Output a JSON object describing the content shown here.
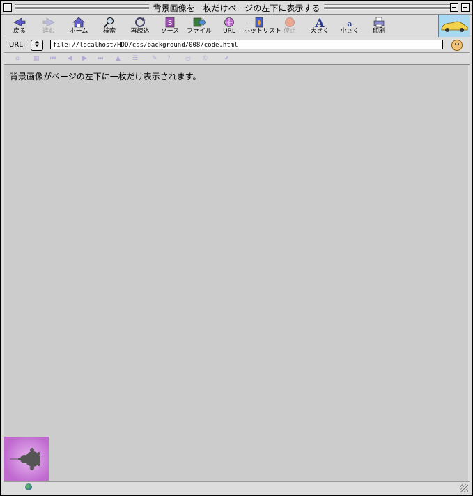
{
  "window": {
    "title": "背景画像を一枚だけページの左下に表示する"
  },
  "toolbar": {
    "buttons": [
      {
        "label": "戻る",
        "icon": "back-arrow-icon"
      },
      {
        "label": "進む",
        "icon": "forward-arrow-icon",
        "disabled": true
      },
      {
        "label": "ホーム",
        "icon": "home-icon"
      },
      {
        "label": "検索",
        "icon": "search-icon"
      },
      {
        "label": "再読込",
        "icon": "reload-icon"
      },
      {
        "label": "ソース",
        "icon": "source-icon"
      },
      {
        "label": "ファイル",
        "icon": "file-icon"
      },
      {
        "label": "URL",
        "icon": "globe-icon"
      },
      {
        "label": "ホットリスト",
        "icon": "hotlist-icon"
      },
      {
        "label": "停止",
        "icon": "stop-icon",
        "disabled": true
      },
      {
        "label": "大きく",
        "icon": "font-larger-icon"
      },
      {
        "label": "小さく",
        "icon": "font-smaller-icon"
      },
      {
        "label": "印刷",
        "icon": "print-icon"
      }
    ]
  },
  "address": {
    "label": "URL:",
    "value": "file://localhost/HDD/css/background/008/code.html"
  },
  "content": {
    "text": "背景画像がページの左下に一枚だけ表示されます。"
  },
  "colors": {
    "content_bg": "#cccccc",
    "chrome_bg": "#dddddd",
    "nav_disabled": "#b5a8d8",
    "fractal_bg": "#c98ad8",
    "fractal_fg": "#555555"
  }
}
